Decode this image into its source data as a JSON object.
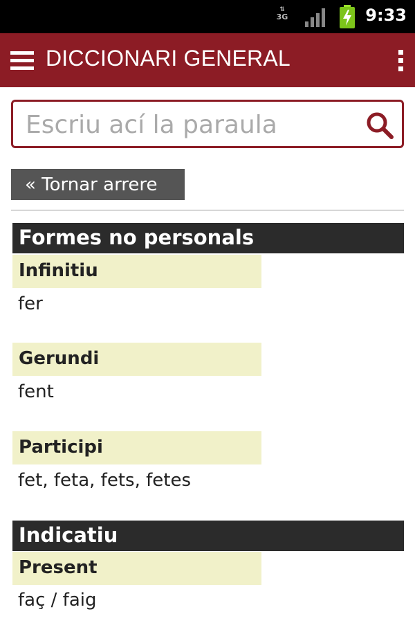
{
  "status_bar": {
    "network": "3G",
    "time": "9:33"
  },
  "app_bar": {
    "title": "DICCIONARI GENERAL"
  },
  "search": {
    "placeholder": "Escriu ací la paraula"
  },
  "back_button": {
    "label": "« Tornar arrere"
  },
  "sections": [
    {
      "title": "Formes no personals",
      "entries": [
        {
          "label": "Infinitiu",
          "value": "fer"
        },
        {
          "label": "Gerundi",
          "value": "fent"
        },
        {
          "label": "Participi",
          "value": "fet, feta, fets, fetes"
        }
      ]
    },
    {
      "title": "Indicatiu",
      "entries": [
        {
          "label": "Present",
          "value": "faç / faig"
        }
      ]
    }
  ],
  "colors": {
    "brand": "#8c1c25",
    "section_header": "#2b2b2b",
    "label_highlight": "#f1f1c9",
    "back_button": "#555555"
  }
}
